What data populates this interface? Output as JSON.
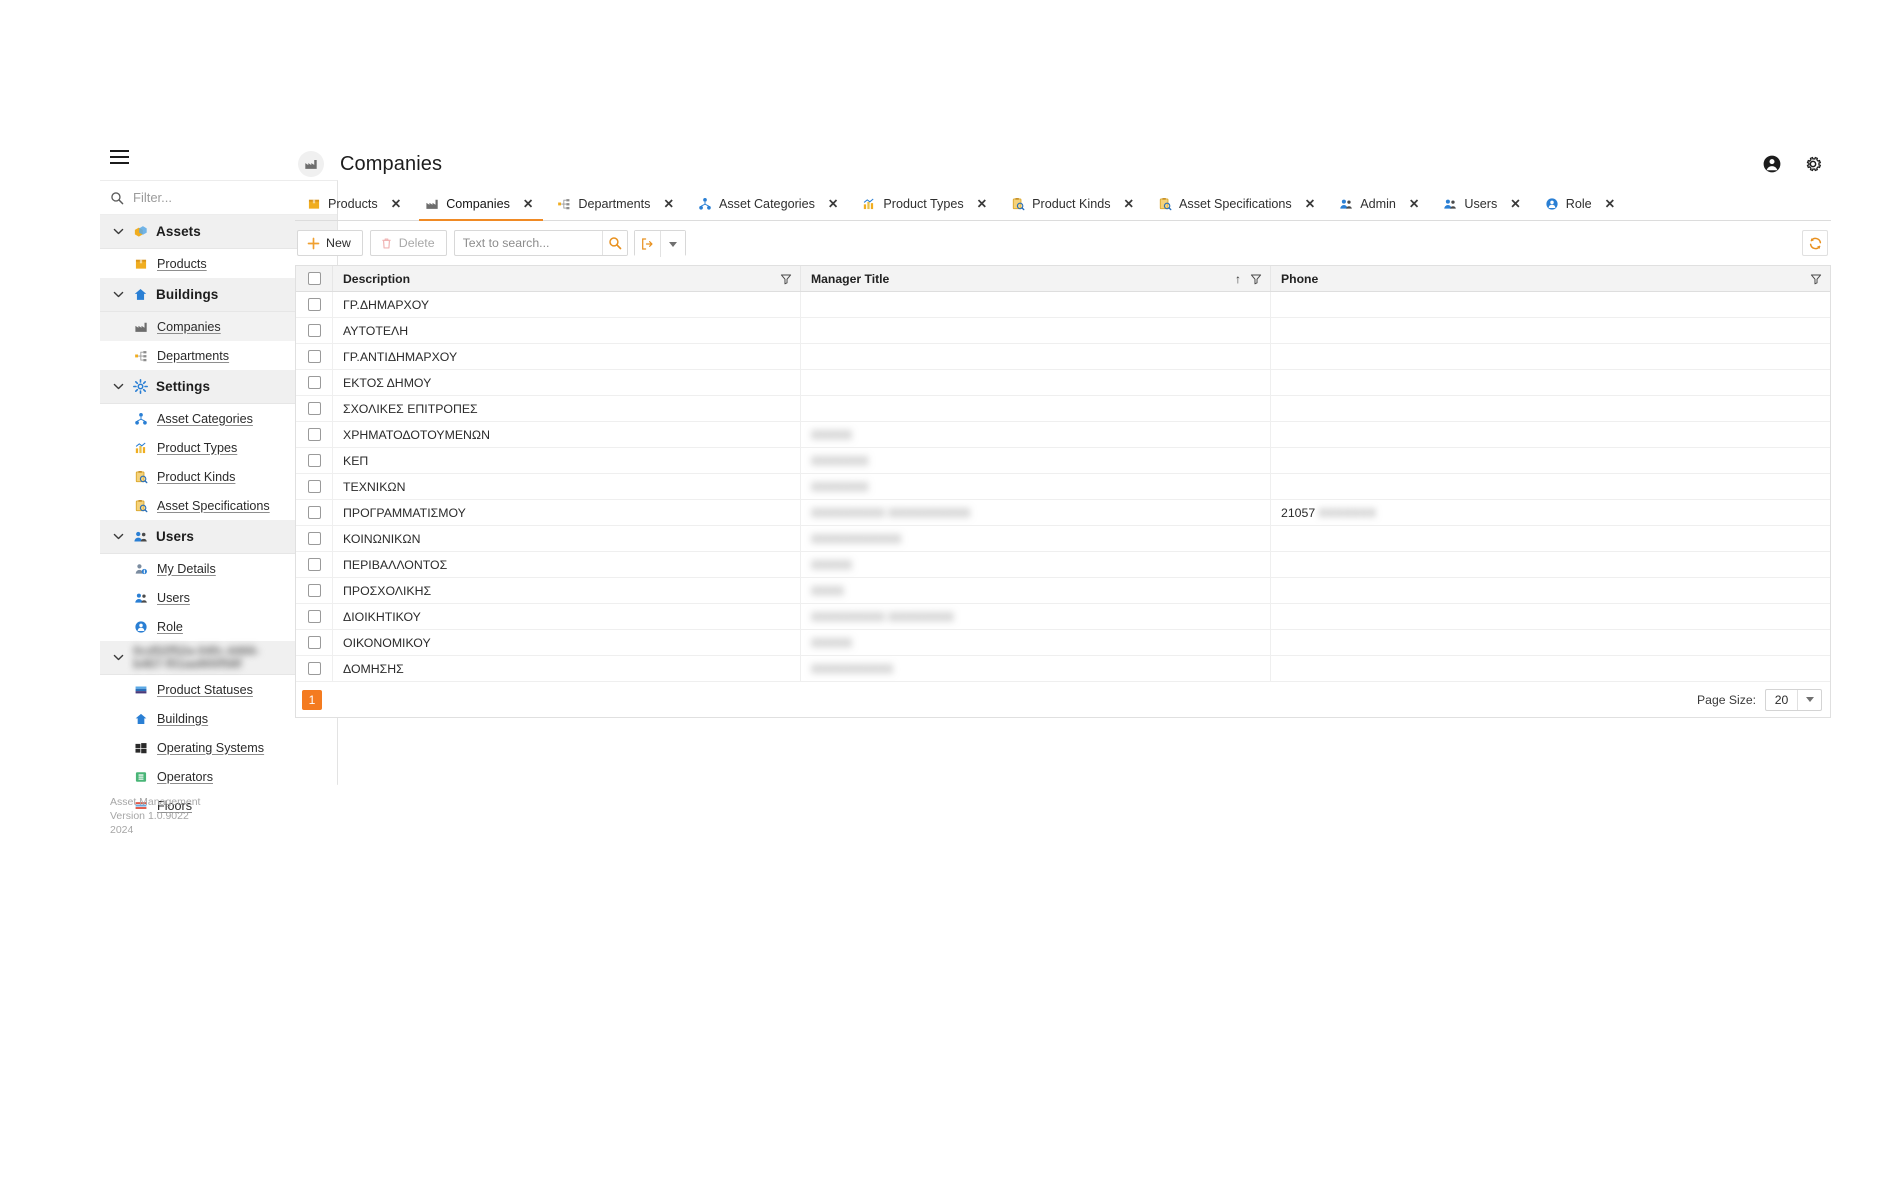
{
  "app": {
    "menu_toggle": "hamburger-menu",
    "footer": {
      "product": "Asset Management",
      "version": "Version 1.0.9022",
      "year": "2024"
    }
  },
  "sidebar": {
    "filter_placeholder": "Filter...",
    "groups": [
      {
        "label": "Assets",
        "icon": "assets-icon",
        "expanded": true,
        "items": [
          {
            "label": "Products",
            "icon": "box-icon",
            "active": false
          }
        ]
      },
      {
        "label": "Buildings",
        "icon": "building-icon",
        "expanded": true,
        "items": [
          {
            "label": "Companies",
            "icon": "factory-icon",
            "active": true
          },
          {
            "label": "Departments",
            "icon": "sitemap-icon",
            "active": false
          }
        ]
      },
      {
        "label": "Settings",
        "icon": "gear-icon",
        "expanded": true,
        "items": [
          {
            "label": "Asset Categories",
            "icon": "hierarchy-icon",
            "active": false
          },
          {
            "label": "Product Types",
            "icon": "chart-icon",
            "active": false
          },
          {
            "label": "Product Kinds",
            "icon": "clipboard-search-icon",
            "active": false
          },
          {
            "label": "Asset Specifications",
            "icon": "clipboard-search-icon",
            "active": false
          }
        ]
      },
      {
        "label": "Users",
        "icon": "users-icon",
        "expanded": true,
        "items": [
          {
            "label": "My Details",
            "icon": "user-detail-icon",
            "active": false
          },
          {
            "label": "Users",
            "icon": "users-icon",
            "active": false
          },
          {
            "label": "Role",
            "icon": "role-icon",
            "active": false
          }
        ]
      },
      {
        "label": "0cd52f52a-04fc-4466-b467-f01aa900f58f",
        "icon": "none",
        "redacted": true,
        "expanded": true,
        "items": [
          {
            "label": "Product Statuses",
            "icon": "status-icon",
            "active": false
          },
          {
            "label": "Buildings",
            "icon": "building-icon",
            "active": false
          },
          {
            "label": "Operating Systems",
            "icon": "windows-icon",
            "active": false
          },
          {
            "label": "Operators",
            "icon": "operator-icon",
            "active": false
          },
          {
            "label": "Floors",
            "icon": "floors-icon",
            "active": false
          }
        ]
      }
    ]
  },
  "header": {
    "title": "Companies",
    "title_icon": "factory-icon",
    "account_icon": "account-circle-icon",
    "settings_icon": "gear-icon"
  },
  "tabs": [
    {
      "label": "Products",
      "icon": "box-icon",
      "active": false,
      "close": "✕"
    },
    {
      "label": "Companies",
      "icon": "factory-icon",
      "active": true,
      "close": "✕"
    },
    {
      "label": "Departments",
      "icon": "sitemap-icon",
      "active": false,
      "close": "✕"
    },
    {
      "label": "Asset Categories",
      "icon": "hierarchy-icon",
      "active": false,
      "close": "✕"
    },
    {
      "label": "Product Types",
      "icon": "chart-icon",
      "active": false,
      "close": "✕"
    },
    {
      "label": "Product Kinds",
      "icon": "clipboard-search-icon",
      "active": false,
      "close": "✕"
    },
    {
      "label": "Asset Specifications",
      "icon": "clipboard-search-icon",
      "active": false,
      "close": "✕"
    },
    {
      "label": "Admin",
      "icon": "users-icon",
      "active": false,
      "close": "✕"
    },
    {
      "label": "Users",
      "icon": "users-icon",
      "active": false,
      "close": "✕"
    },
    {
      "label": "Role",
      "icon": "role-icon",
      "active": false,
      "close": "✕"
    }
  ],
  "toolbar": {
    "new_label": "New",
    "delete_label": "Delete",
    "search_placeholder": "Text to search...",
    "search_value": "",
    "search_icon": "search-icon",
    "export_icon": "export-icon",
    "dropdown_icon": "chevron-down-icon",
    "refresh_icon": "refresh-icon"
  },
  "grid": {
    "columns": [
      {
        "key": "description",
        "label": "Description",
        "filter": true,
        "sort": ""
      },
      {
        "key": "manager_title",
        "label": "Manager Title",
        "filter": true,
        "sort": "asc"
      },
      {
        "key": "phone",
        "label": "Phone",
        "filter": true,
        "sort": ""
      }
    ],
    "rows": [
      {
        "description": "ΓΡ.ΔΗΜΑΡΧΟΥ",
        "manager_title": "",
        "manager_redacted": false,
        "phone": "",
        "phone_redacted": false
      },
      {
        "description": "ΑΥΤΟΤΕΛΗ",
        "manager_title": "",
        "manager_redacted": false,
        "phone": "",
        "phone_redacted": false
      },
      {
        "description": "ΓΡ.ΑΝΤΙΔΗΜΑΡΧΟΥ",
        "manager_title": "",
        "manager_redacted": false,
        "phone": "",
        "phone_redacted": false
      },
      {
        "description": "ΕΚΤΟΣ ΔΗΜΟΥ",
        "manager_title": "",
        "manager_redacted": false,
        "phone": "",
        "phone_redacted": false
      },
      {
        "description": "ΣΧΟΛΙΚΕΣ ΕΠΙΤΡΟΠΕΣ",
        "manager_title": "",
        "manager_redacted": false,
        "phone": "",
        "phone_redacted": false
      },
      {
        "description": "ΧΡΗΜΑΤΟΔΟΤΟΥΜΕΝΩΝ",
        "manager_title": "ΧΧΧΧΧ",
        "manager_redacted": true,
        "phone": "",
        "phone_redacted": false
      },
      {
        "description": "ΚΕΠ",
        "manager_title": "ΧΧΧΧΧΧΧ",
        "manager_redacted": true,
        "phone": "",
        "phone_redacted": false
      },
      {
        "description": "ΤΕΧΝΙΚΩΝ",
        "manager_title": "ΧΧΧΧΧΧΧ",
        "manager_redacted": true,
        "phone": "",
        "phone_redacted": false
      },
      {
        "description": "ΠΡΟΓΡΑΜΜΑΤΙΣΜΟΥ",
        "manager_title": "ΧΧΧΧΧΧΧΧΧ ΧΧΧΧΧΧΧΧΧΧ",
        "manager_redacted": true,
        "phone": "21057",
        "phone_redacted": true
      },
      {
        "description": "ΚΟΙΝΩΝΙΚΩΝ",
        "manager_title": "ΧΧΧΧΧΧΧΧΧΧΧ",
        "manager_redacted": true,
        "phone": "",
        "phone_redacted": false
      },
      {
        "description": "ΠΕΡΙΒΑΛΛΟΝΤΟΣ",
        "manager_title": "ΧΧΧΧΧ",
        "manager_redacted": true,
        "phone": "",
        "phone_redacted": false
      },
      {
        "description": "ΠΡΟΣΧΟΛΙΚΗΣ",
        "manager_title": "ΧΧΧΧ",
        "manager_redacted": true,
        "phone": "",
        "phone_redacted": false
      },
      {
        "description": "ΔΙΟΙΚΗΤΙΚΟΥ",
        "manager_title": "ΧΧΧΧΧΧΧΧΧ ΧΧΧΧΧΧΧΧ",
        "manager_redacted": true,
        "phone": "",
        "phone_redacted": false
      },
      {
        "description": "ΟΙΚΟΝΟΜΙΚΟΥ",
        "manager_title": "ΧΧΧΧΧ",
        "manager_redacted": true,
        "phone": "",
        "phone_redacted": false
      },
      {
        "description": "ΔΟΜΗΣΗΣ",
        "manager_title": "ΧΧΧΧΧΧΧΧΧΧ",
        "manager_redacted": true,
        "phone": "",
        "phone_redacted": false
      }
    ]
  },
  "pager": {
    "current_page": "1",
    "page_size_label": "Page Size:",
    "page_size_value": "20"
  },
  "colors": {
    "accent_orange": "#f47b20",
    "tab_underline": "#f08a24",
    "blue_icon": "#2a7fd4",
    "yellow_icon": "#f0ad20",
    "header_bg": "#f3f3f3"
  }
}
